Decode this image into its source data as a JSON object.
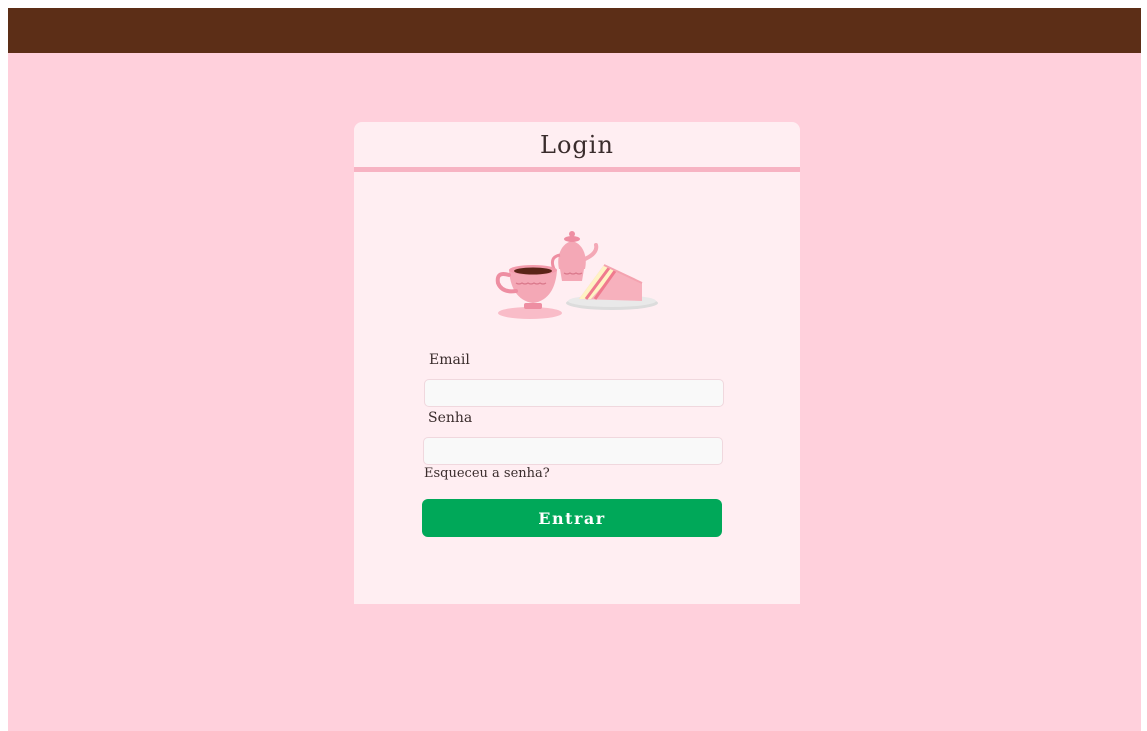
{
  "colors": {
    "page_background": "#ffd0dc",
    "topbar": "#5c2e17",
    "card_background": "#ffeef2",
    "header_rule": "#f7b3c3",
    "primary_button": "#00a859",
    "text": "#3a2c2c"
  },
  "login": {
    "title": "Login",
    "illustration": "tea-cup-teapot-cake-illustration",
    "email": {
      "label": "Email",
      "value": "",
      "placeholder": ""
    },
    "password": {
      "label": "Senha",
      "value": "",
      "placeholder": ""
    },
    "forgot_password": "Esqueceu a senha?",
    "submit": "Entrar"
  }
}
